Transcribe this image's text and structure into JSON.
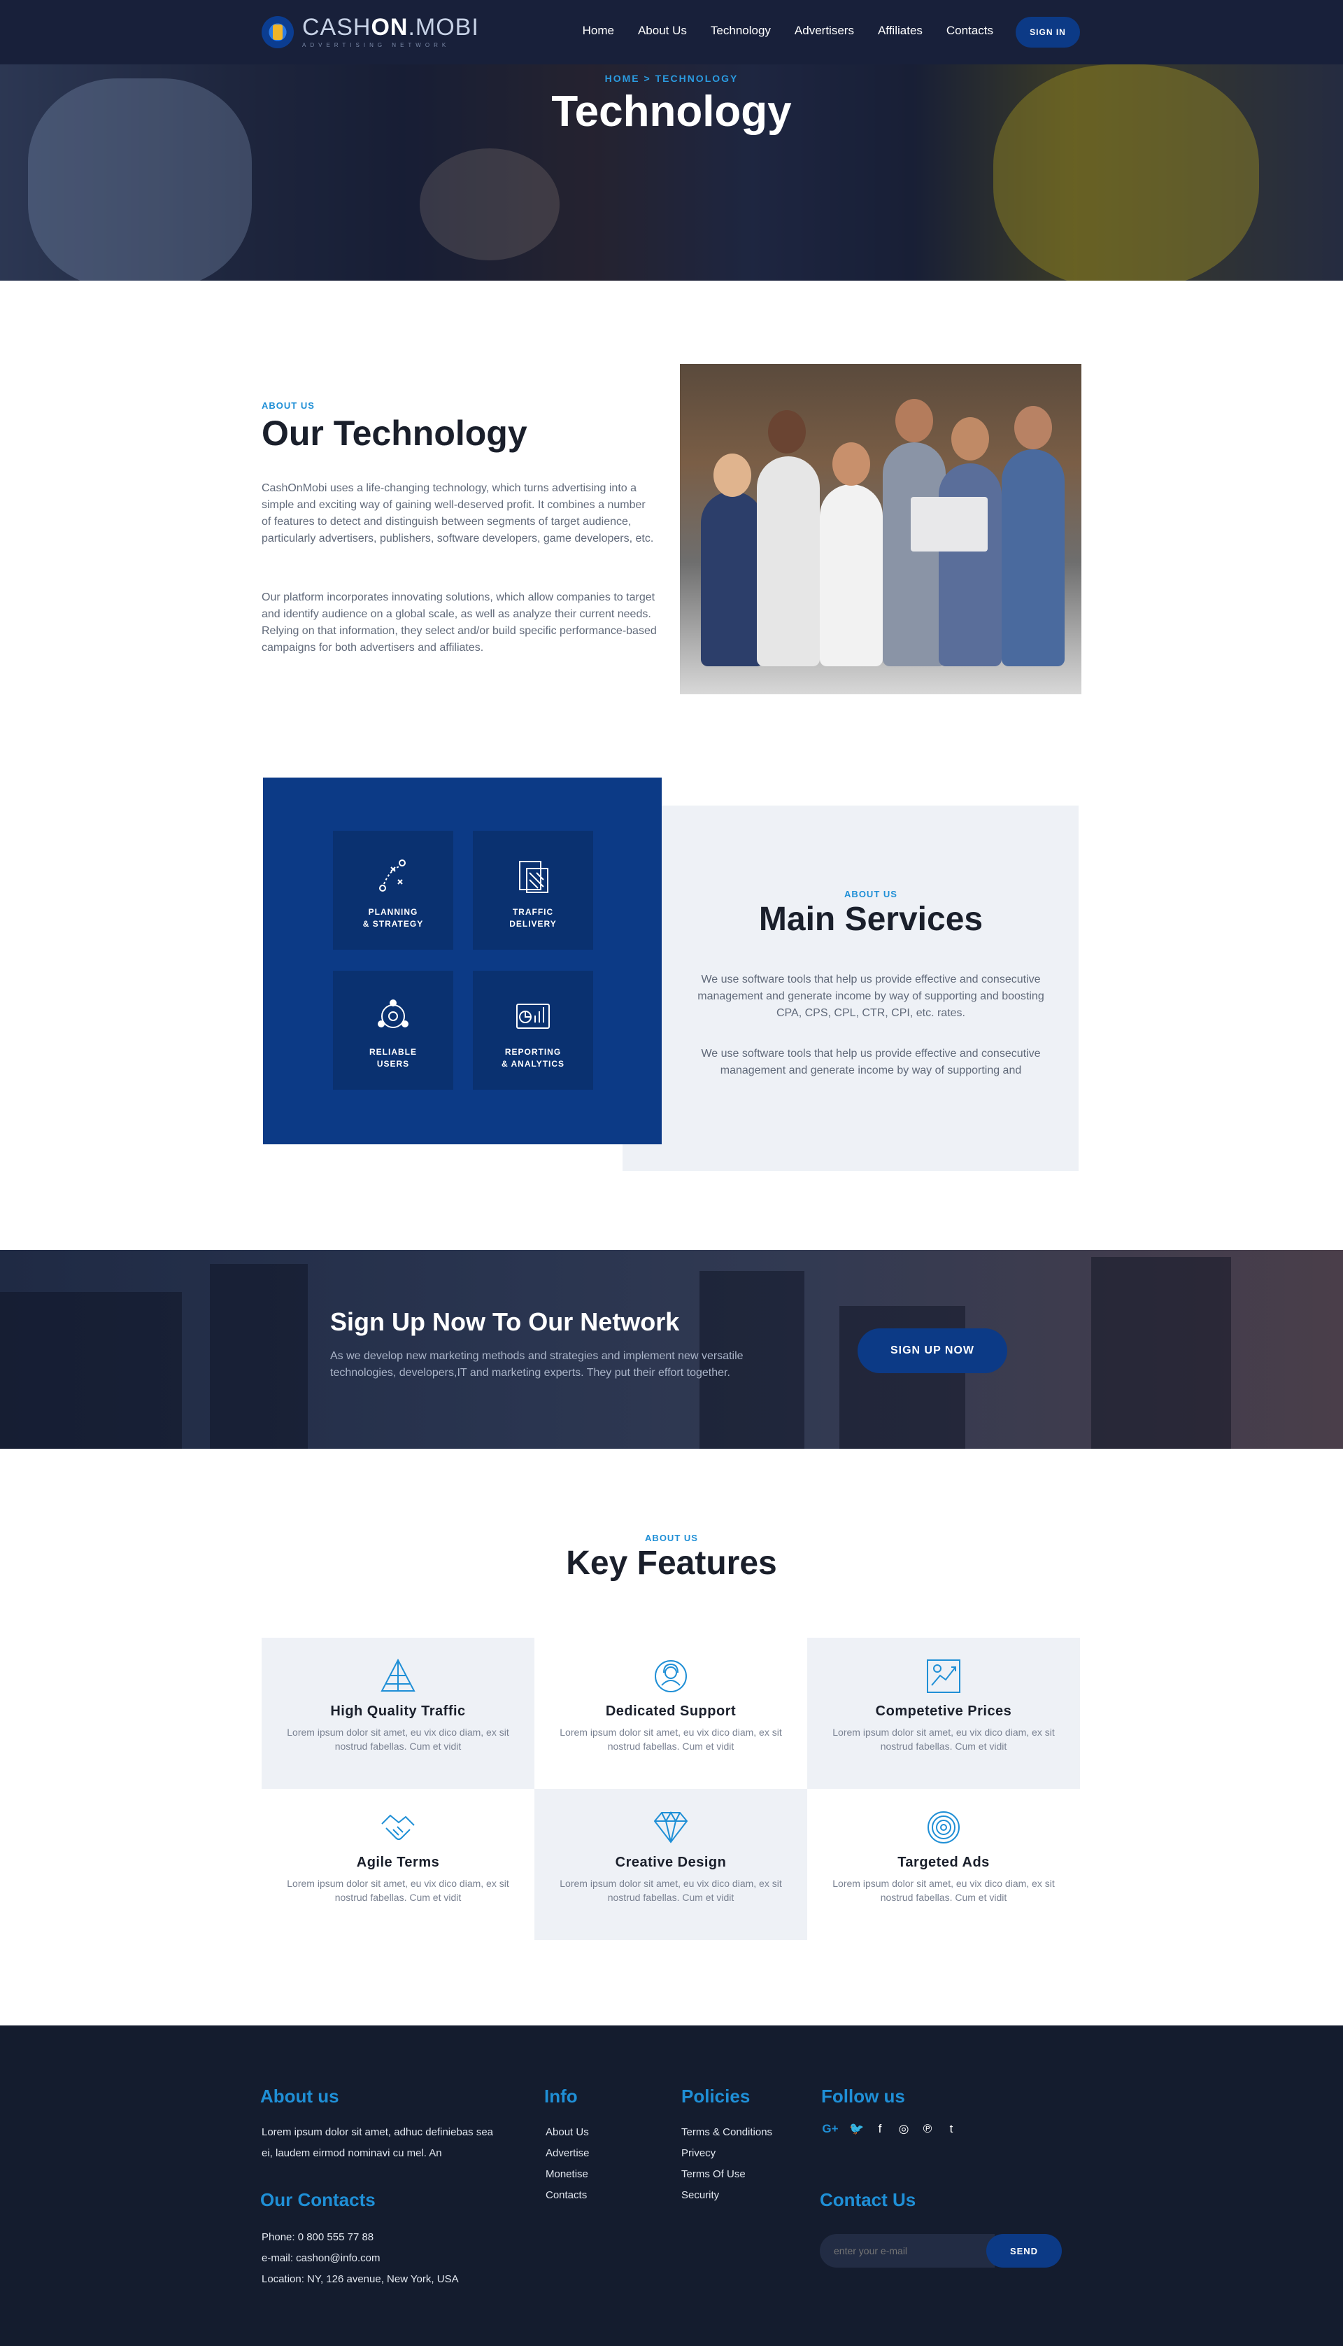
{
  "header": {
    "logo_main": "CASH",
    "logo_strong": "ON",
    "logo_tail": ".MOBI",
    "logo_sub": "ADVERTISING NETWORK",
    "nav": [
      "Home",
      "About Us",
      "Technology",
      "Advertisers",
      "Affiliates",
      "Contacts"
    ],
    "signin_label": "SIGN IN"
  },
  "hero": {
    "breadcrumb": "HOME > TECHNOLOGY",
    "title": "Technology"
  },
  "about": {
    "eyebrow": "ABOUT US",
    "title": "Our Technology",
    "p1": "CashOnMobi uses a life-changing technology, which turns advertising into a simple and exciting way of gaining well-deserved profit. It combines a number of features to detect and distinguish between segments of target audience, particularly advertisers, publishers, software developers, game developers, etc.",
    "p2": "Our platform incorporates innovating solutions, which allow companies to target and identify audience on a global scale, as well as analyze their current needs. Relying on that information, they select and/or build specific performance-based campaigns for both advertisers and affiliates."
  },
  "services": {
    "tiles": [
      {
        "label": "PLANNING\n& STRATEGY",
        "icon": "strategy-icon"
      },
      {
        "label": "TRAFFIC\nDELIVERY",
        "icon": "traffic-icon"
      },
      {
        "label": "RELIABLE\nUSERS",
        "icon": "users-network-icon"
      },
      {
        "label": "REPORTING\n& ANALYTICS",
        "icon": "analytics-icon"
      }
    ],
    "eyebrow": "ABOUT US",
    "title": "Main Services",
    "p1": "We use software tools that help us provide effective and consecutive management and generate income by way of supporting and boosting CPA, CPS, CPL, CTR, CPI, etc. rates.",
    "p2": "We use software tools that help us provide effective and consecutive management and generate income by way of supporting and"
  },
  "cta": {
    "title": "Sign Up Now To Our Network",
    "text": "As we develop new marketing methods and strategies and implement new versatile technologies, developers,IT and marketing experts. They put their effort together.",
    "button": "SIGN UP NOW"
  },
  "features": {
    "eyebrow": "ABOUT US",
    "title": "Key Features",
    "items": [
      {
        "title": "High Quality Traffic",
        "desc": "Lorem ipsum dolor sit amet, eu vix dico diam, ex sit nostrud fabellas. Cum et vidit",
        "icon": "pyramid-icon"
      },
      {
        "title": "Dedicated Support",
        "desc": "Lorem ipsum dolor sit amet, eu vix dico diam, ex sit nostrud fabellas. Cum et vidit",
        "icon": "support-agent-icon"
      },
      {
        "title": "Competetive Prices",
        "desc": "Lorem ipsum dolor sit amet, eu vix dico diam, ex sit nostrud fabellas. Cum et vidit",
        "icon": "price-chart-icon"
      },
      {
        "title": "Agile Terms",
        "desc": "Lorem ipsum dolor sit amet, eu vix dico diam, ex sit nostrud fabellas. Cum et vidit",
        "icon": "handshake-icon"
      },
      {
        "title": "Creative Design",
        "desc": "Lorem ipsum dolor sit amet, eu vix dico diam, ex sit nostrud fabellas. Cum et vidit",
        "icon": "diamond-icon"
      },
      {
        "title": "Targeted Ads",
        "desc": "Lorem ipsum dolor sit amet, eu vix dico diam, ex sit nostrud fabellas. Cum et vidit",
        "icon": "target-icon"
      }
    ]
  },
  "footer": {
    "about_heading": "About us",
    "about_text": "Lorem ipsum dolor sit amet, adhuc definiebas sea ei, laudem eirmod nominavi cu mel. An",
    "info_heading": "Info",
    "info_links": [
      "About Us",
      "Advertise",
      "Monetise",
      "Contacts"
    ],
    "policies_heading": "Policies",
    "policies_links": [
      "Terms & Conditions",
      "Privecy",
      "Terms Of Use",
      "Security"
    ],
    "follow_heading": "Follow us",
    "social": [
      {
        "glyph": "G+",
        "icon": "google-plus-icon"
      },
      {
        "glyph": "🐦",
        "icon": "twitter-icon"
      },
      {
        "glyph": "f",
        "icon": "facebook-icon"
      },
      {
        "glyph": "◎",
        "icon": "instagram-icon"
      },
      {
        "glyph": "℗",
        "icon": "pinterest-icon"
      },
      {
        "glyph": "t",
        "icon": "tumblr-icon"
      }
    ],
    "contacts_heading": "Our Contacts",
    "phone": "Phone: 0 800 555 77 88",
    "email": "e-mail: cashon@info.com",
    "location": "Location: NY, 126 avenue, New York, USA",
    "contact_us_heading": "Contact Us",
    "email_placeholder": "enter your e-mail",
    "send_label": "SEND"
  },
  "colors": {
    "navy": "#18203a",
    "brand_blue": "#0c3a86",
    "accent_blue": "#1f8fd6",
    "light_grey": "#eef1f6",
    "footer_bg": "#141c2e"
  }
}
